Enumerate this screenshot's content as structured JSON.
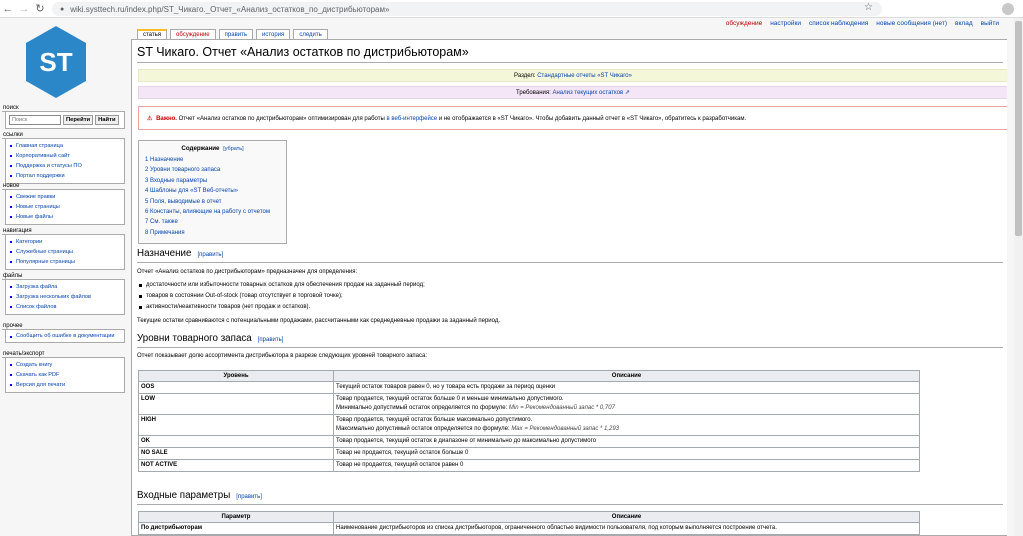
{
  "browser": {
    "url": "wiki.systtech.ru/index.php/ST_Чикаго._Отчет_«Анализ_остатков_по_дистрибьюторам»"
  },
  "personal_tools": [
    "обсуждение",
    "настройки",
    "список наблюдения",
    "новые сообщения (нет)",
    "вклад",
    "выйти"
  ],
  "logo": {
    "text": "ST",
    "color": "#2c87c9"
  },
  "sidebar": {
    "search": {
      "heading": "поиск",
      "placeholder": "Поиск",
      "go_label": "Перейти",
      "find_label": "Найти"
    },
    "portlets": [
      {
        "heading": "ссылки",
        "items": [
          "Главная страница",
          "Корпоративный сайт",
          "Поддержка и статусы ПО",
          "Портал поддержки"
        ]
      },
      {
        "heading": "новое",
        "items": [
          "Свежие правки",
          "Новые страницы",
          "Новые файлы"
        ]
      },
      {
        "heading": "навигация",
        "items": [
          "Категории",
          "Служебные страницы",
          "Популярные страницы"
        ]
      },
      {
        "heading": "файлы",
        "items": [
          "Загрузка файла",
          "Загрузка нескольких файлов",
          "Список файлов"
        ]
      },
      {
        "heading": "прочее",
        "items": [
          "Сообщить об ошибке в документации"
        ]
      },
      {
        "heading": "печать/экспорт",
        "items": [
          "Создать книгу",
          "Скачать как PDF",
          "Версия для печати"
        ]
      }
    ]
  },
  "tabs": [
    "статья",
    "обсуждение",
    "править",
    "история",
    "следить"
  ],
  "page": {
    "title": "ST Чикаго. Отчет «Анализ остатков по дистрибьюторам»",
    "section_label": "Раздел:",
    "section_link": "Стандартные отчеты «ST Чикаго»",
    "req_label": "Требования:",
    "req_link": "Анализ текущих остатков",
    "warn_strong": "Важно.",
    "warn_text1": "Отчет «Анализ остатков по дистрибьюторам» оптимизирован для работы",
    "warn_link": "в веб-интерфейсе",
    "warn_text2": "и не отображается в «ST Чикаго». Чтобы добавить данный отчет в «ST Чикаго», обратитесь к разработчикам."
  },
  "toc": {
    "title": "Содержание",
    "toggle": "[убрать]",
    "items": [
      "1 Назначение",
      "2 Уровни товарного запаса",
      "3 Входные параметры",
      "4 Шаблоны для «ST Веб-отчеты»",
      "5 Поля, выводимые в отчет",
      "6 Константы, влияющие на работу с отчетом",
      "7 См. также",
      "8 Примечания"
    ]
  },
  "sections": {
    "edit_label": "[править]",
    "purpose": {
      "title": "Назначение",
      "intro": "Отчет «Анализ остатков по дистрибьюторам» предназначен для определения:",
      "bullets": [
        "достаточности или избыточности товарных остатков для обеспечения продаж на заданный период;",
        "товаров в состоянии Out-of-stock (товар отсутствует в торговой точке);",
        "активности/неактивности товаров (нет продаж и остатков)."
      ],
      "outro": "Текущие остатки сравниваются с потенциальными продажами, рассчитанными как среднедневные продажи за заданный период."
    },
    "levels": {
      "title": "Уровни товарного запаса",
      "intro": "Отчет показывает долю ассортимента дистрибьютора в разрезе следующих уровней товарного запаса:",
      "headers": [
        "Уровень",
        "Описание"
      ],
      "rows": [
        {
          "k": "OOS",
          "d1": "Текущий остаток товаров равен 0, но у товара есть продажи за период оценки",
          "d2": ""
        },
        {
          "k": "LOW",
          "d1": "Товар продается, текущий остаток больше 0 и меньше минимально допустимого.",
          "d2": "Минимально допустимый остаток определяется по формуле: ",
          "f": "Min = Рекомендованный запас * 0,707"
        },
        {
          "k": "HIGH",
          "d1": "Товар продается, текущий остаток больше максимально допустимого.",
          "d2": "Максимально допустимый остаток определяется по формуле: ",
          "f": "Max = Рекомендованный запас * 1,293"
        },
        {
          "k": "OK",
          "d1": "Товар продается, текущий остаток в диапазоне от минимально до максимально допустимого",
          "d2": ""
        },
        {
          "k": "NO SALE",
          "d1": "Товар не продается, текущий остаток больше 0",
          "d2": ""
        },
        {
          "k": "NOT ACTIVE",
          "d1": "Товар не продается, текущий остаток равен 0",
          "d2": ""
        }
      ]
    },
    "params": {
      "title": "Входные параметры",
      "headers": [
        "Параметр",
        "Описание"
      ],
      "rows": [
        {
          "k": "По дистрибьюторам",
          "d1": "Наименование дистрибьюторов из списка дистрибьюторов, ограниченного областью видимости пользователя, под которым выполняется построение отчета."
        }
      ]
    }
  }
}
